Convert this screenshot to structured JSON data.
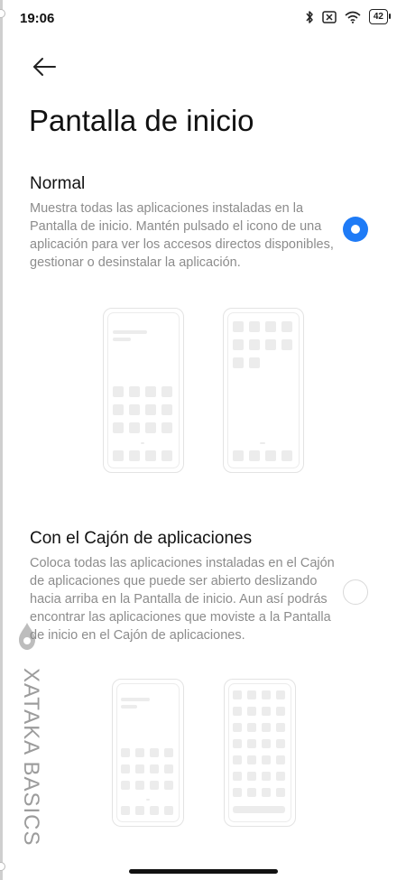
{
  "status_bar": {
    "time": "19:06",
    "battery": "42",
    "icons": [
      "bluetooth-icon",
      "sim-off-icon",
      "wifi-icon",
      "battery-icon"
    ]
  },
  "header": {
    "back_icon": "arrow-left-icon",
    "title": "Pantalla de inicio"
  },
  "options": [
    {
      "title": "Normal",
      "description": "Muestra todas las aplicaciones instaladas en la Pantalla de inicio. Mantén pulsado el icono de una aplicación para ver los accesos directos disponibles, gestionar o desinstalar la aplicación.",
      "selected": true
    },
    {
      "title": "Con el Cajón de aplicaciones",
      "description": "Coloca todas las aplicaciones instaladas en el Cajón de aplicaciones que puede ser abierto deslizando hacia arriba en la Pantalla de inicio. Aun así podrás encontrar las aplicaciones que moviste a la Pantalla de inicio en el Cajón de aplicaciones.",
      "selected": false
    }
  ],
  "watermark": {
    "text": "XATAKA BASICS"
  },
  "colors": {
    "accent": "#1f7bf6",
    "description_text": "#8c8c8c",
    "illustration": "#ececec"
  }
}
